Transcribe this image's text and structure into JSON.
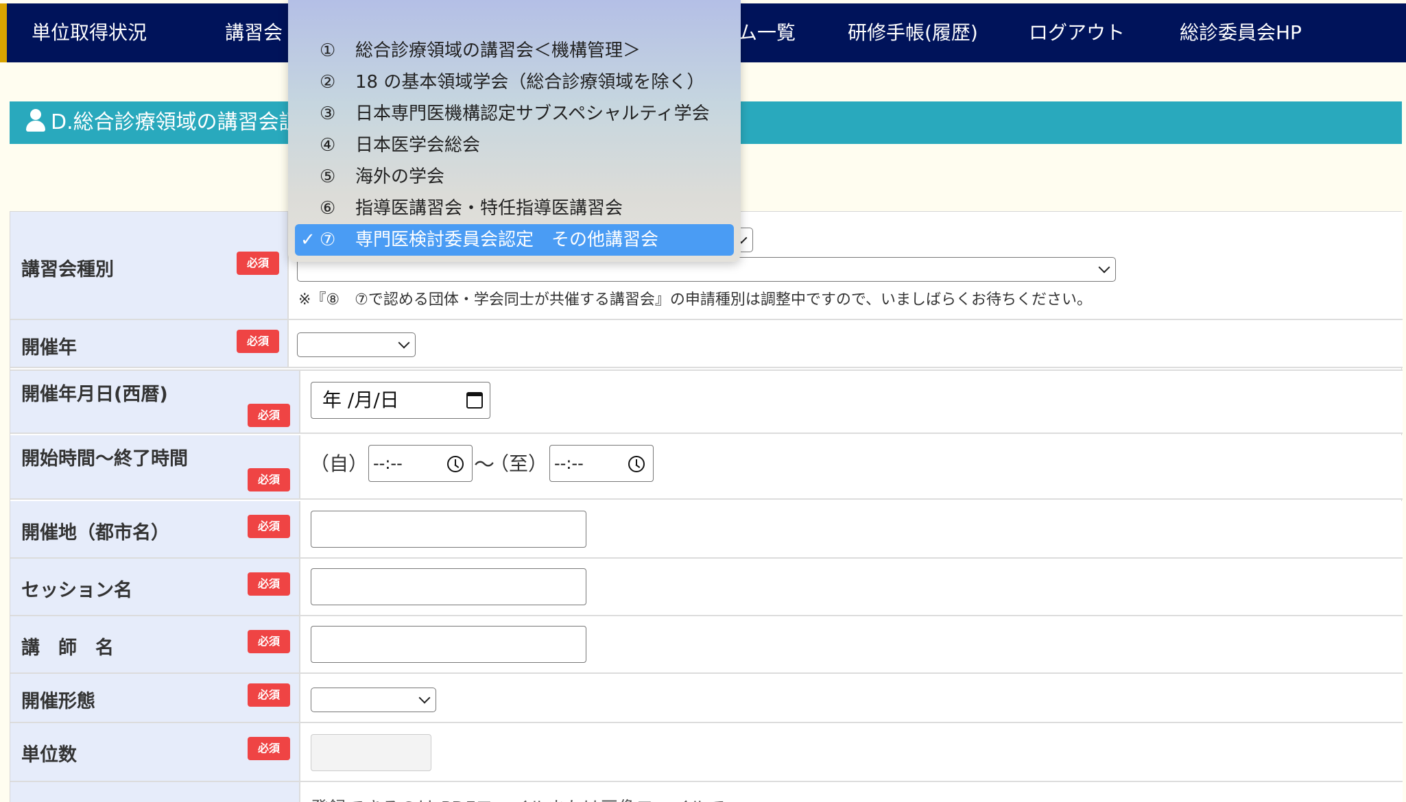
{
  "nav": {
    "items": [
      {
        "label": "単位取得状況"
      },
      {
        "label": "講習会"
      },
      {
        "label": "ム一覧"
      },
      {
        "label": "研修手帳(履歴)"
      },
      {
        "label": "ログアウト"
      },
      {
        "label": "総診委員会HP"
      }
    ]
  },
  "section": {
    "title": "D.総合診療領域の講習会証"
  },
  "dropdown": {
    "options": [
      {
        "num": "①",
        "label": "総合診療領域の講習会＜機構管理＞",
        "selected": false
      },
      {
        "num": "②",
        "label": "18 の基本領域学会（総合診療領域を除く）",
        "selected": false
      },
      {
        "num": "③",
        "label": "日本専門医機構認定サブスペシャルティ学会",
        "selected": false
      },
      {
        "num": "④",
        "label": "日本医学会総会",
        "selected": false
      },
      {
        "num": "⑤",
        "label": "海外の学会",
        "selected": false
      },
      {
        "num": "⑥",
        "label": "指導医講習会・特任指導医講習会",
        "selected": false
      },
      {
        "num": "⑦",
        "label": "専門医検討委員会認定　その他講習会",
        "selected": true
      }
    ],
    "check_mark": "✓"
  },
  "form": {
    "required_badge": "必須",
    "fields": {
      "kind": {
        "label": "講習会種別",
        "note": "※『⑧　⑦で認める団体・学会同士が共催する講習会』の申請種別は調整中ですので、いましばらくお待ちください。"
      },
      "year": {
        "label": "開催年"
      },
      "date": {
        "label": "開催年月日(西暦)",
        "placeholder": "年 /月/日"
      },
      "time": {
        "label": "開始時間～終了時間",
        "from_label": "（自）",
        "to_label": "（至）",
        "separator": "〜",
        "from_value": "--:--",
        "to_value": "--:--"
      },
      "city": {
        "label": "開催地（都市名）"
      },
      "session": {
        "label": "セッション名"
      },
      "lecturer": {
        "label": "講　師　名"
      },
      "format": {
        "label": "開催形態"
      },
      "credits": {
        "label": "単位数"
      },
      "upload": {
        "note": "登録できるのは PDFファイルまたは画像ファイルで"
      }
    }
  }
}
